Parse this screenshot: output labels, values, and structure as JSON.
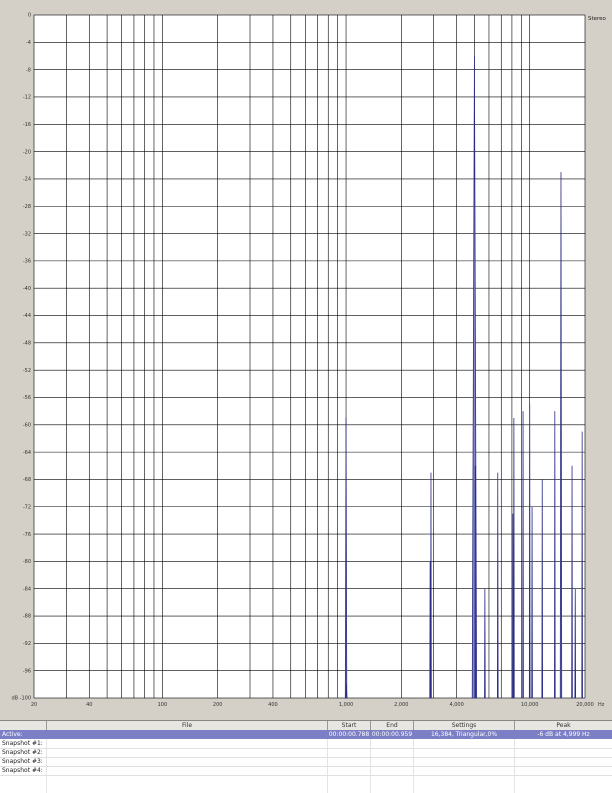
{
  "chart_data": {
    "type": "area",
    "channel_label": "Stereo",
    "y_axis": {
      "ticks": [
        "0",
        "-4",
        "-8",
        "-12",
        "-16",
        "-20",
        "-24",
        "-28",
        "-32",
        "-36",
        "-40",
        "-44",
        "-48",
        "-52",
        "-56",
        "-60",
        "-64",
        "-68",
        "-72",
        "-76",
        "-80",
        "-84",
        "-88",
        "-92",
        "-96",
        "dB -100"
      ],
      "ylim": [
        -100,
        0
      ],
      "grid": true
    },
    "x_axis": {
      "scale": "log",
      "xlim": [
        20,
        20000
      ],
      "ticks": [
        {
          "value": 20,
          "label": "20"
        },
        {
          "value": 40,
          "label": "40"
        },
        {
          "value": 100,
          "label": "100"
        },
        {
          "value": 200,
          "label": "200"
        },
        {
          "value": 400,
          "label": "400"
        },
        {
          "value": 1000,
          "label": "1,000"
        },
        {
          "value": 2000,
          "label": "2,000"
        },
        {
          "value": 4000,
          "label": "4,000"
        },
        {
          "value": 10000,
          "label": "10,000"
        },
        {
          "value": 20000,
          "label": "20,000"
        }
      ],
      "unit": "Hz",
      "grid": true
    },
    "peaks": [
      {
        "freq": 1000,
        "db": -59,
        "width": 0.004
      },
      {
        "freq": 1005,
        "db": -98,
        "width": 0.003
      },
      {
        "freq": 2900,
        "db": -67,
        "width": 0.002
      },
      {
        "freq": 2870,
        "db": -80,
        "width": 0.002
      },
      {
        "freq": 5000,
        "db": -6,
        "width": 0.012
      },
      {
        "freq": 5050,
        "db": -66,
        "width": 0.002
      },
      {
        "freq": 5700,
        "db": -84,
        "width": 0.002
      },
      {
        "freq": 6700,
        "db": -67,
        "width": 0.002
      },
      {
        "freq": 8200,
        "db": -59,
        "width": 0.002
      },
      {
        "freq": 8100,
        "db": -73,
        "width": 0.002
      },
      {
        "freq": 9200,
        "db": -58,
        "width": 0.002
      },
      {
        "freq": 10000,
        "db": -57,
        "width": 0.002
      },
      {
        "freq": 10300,
        "db": -72,
        "width": 0.002
      },
      {
        "freq": 11700,
        "db": -68,
        "width": 0.002
      },
      {
        "freq": 13700,
        "db": -58,
        "width": 0.002
      },
      {
        "freq": 14800,
        "db": -23,
        "width": 0.004
      },
      {
        "freq": 17000,
        "db": -66,
        "width": 0.002
      },
      {
        "freq": 17700,
        "db": -84,
        "width": 0.002
      },
      {
        "freq": 19300,
        "db": -61,
        "width": 0.002
      }
    ],
    "colors": {
      "fill": "#8585c8",
      "stroke": "#2c2c86",
      "grid": "#000000",
      "plot_bg": "#ffffff"
    }
  },
  "panel": {
    "headers": {
      "name": "",
      "file": "File",
      "start": "Start",
      "end": "End",
      "settings": "Settings",
      "peak": "Peak"
    },
    "active": {
      "label": "Active:",
      "file": "",
      "start": "00:00:00.788",
      "end": "00:00:00.959",
      "settings": "16,384, Triangular,0%",
      "peak": "-6 dB at 4,999 Hz"
    },
    "snapshots": [
      {
        "label": "Snapshot #1:"
      },
      {
        "label": "Snapshot #2:"
      },
      {
        "label": "Snapshot #3:"
      },
      {
        "label": "Snapshot #4:"
      }
    ]
  }
}
